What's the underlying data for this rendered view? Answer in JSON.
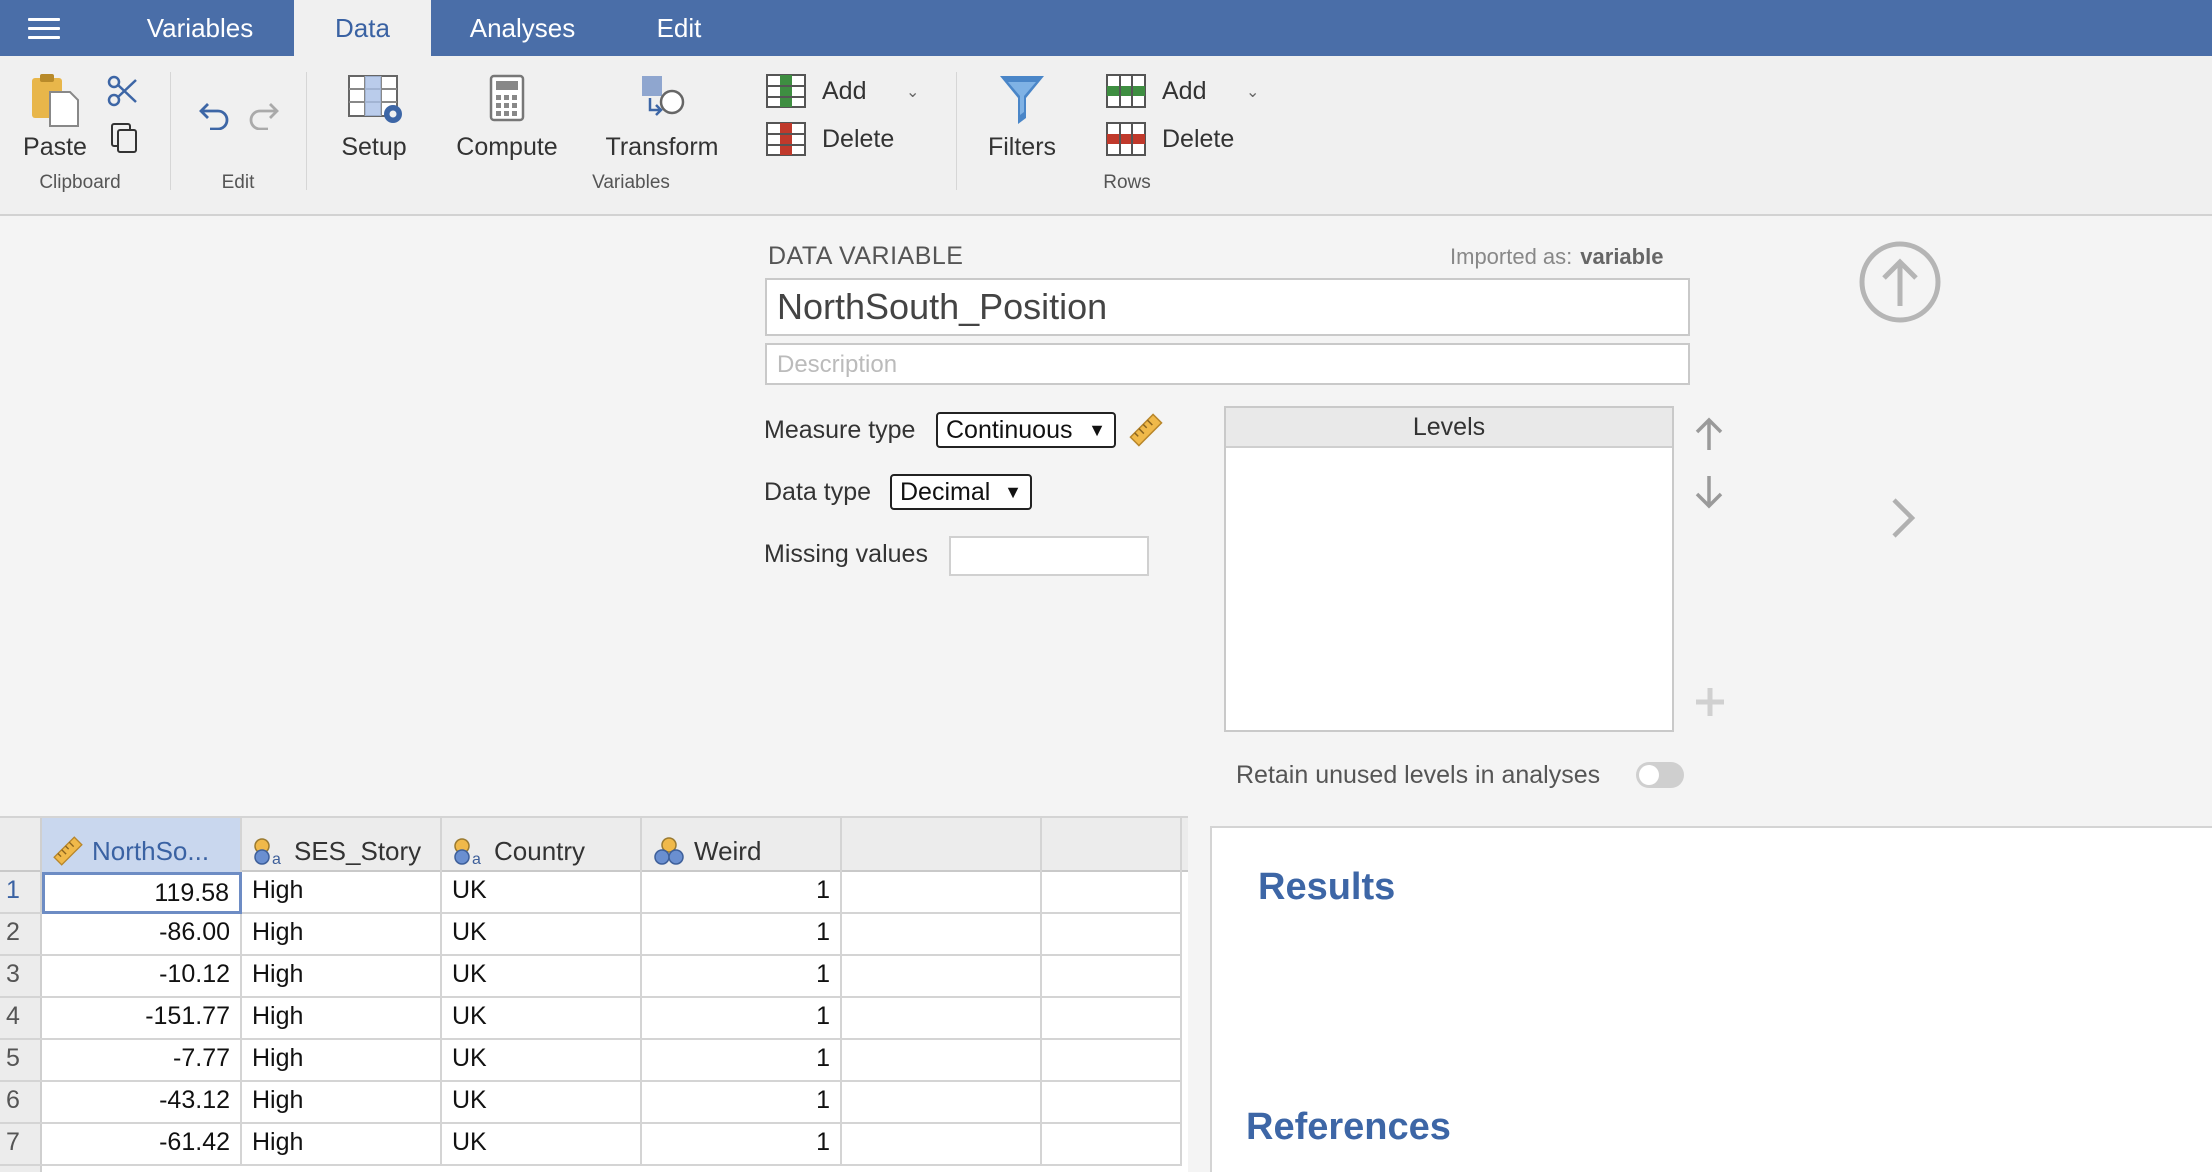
{
  "menubar": {
    "tabs": [
      {
        "label": "Variables"
      },
      {
        "label": "Data"
      },
      {
        "label": "Analyses"
      },
      {
        "label": "Edit"
      }
    ],
    "active_tab": "Data"
  },
  "ribbon": {
    "clipboard": {
      "paste": "Paste",
      "group": "Clipboard"
    },
    "edit": {
      "group": "Edit"
    },
    "variables": {
      "setup": "Setup",
      "compute": "Compute",
      "transform": "Transform",
      "add": "Add",
      "delete": "Delete",
      "group": "Variables"
    },
    "filters": {
      "label": "Filters"
    },
    "rows": {
      "add": "Add",
      "delete": "Delete",
      "group": "Rows"
    }
  },
  "editor": {
    "section_label": "DATA VARIABLE",
    "imported_label": "Imported as:",
    "imported_value": "variable",
    "name": "NorthSouth_Position",
    "description_placeholder": "Description",
    "measure_type_label": "Measure type",
    "measure_type": "Continuous",
    "data_type_label": "Data type",
    "data_type": "Decimal",
    "missing_label": "Missing values",
    "levels_label": "Levels",
    "retain_label": "Retain unused levels in analyses",
    "retain_on": false
  },
  "sheet": {
    "columns": [
      {
        "name": "NorthSo...",
        "type": "continuous"
      },
      {
        "name": "SES_Story",
        "type": "nominal-text"
      },
      {
        "name": "Country",
        "type": "nominal-text"
      },
      {
        "name": "Weird",
        "type": "nominal"
      },
      {
        "name": "",
        "type": ""
      },
      {
        "name": "",
        "type": ""
      }
    ],
    "rows": [
      {
        "n": "1",
        "cells": [
          "119.58",
          "High",
          "UK",
          "1"
        ]
      },
      {
        "n": "2",
        "cells": [
          "-86.00",
          "High",
          "UK",
          "1"
        ]
      },
      {
        "n": "3",
        "cells": [
          "-10.12",
          "High",
          "UK",
          "1"
        ]
      },
      {
        "n": "4",
        "cells": [
          "-151.77",
          "High",
          "UK",
          "1"
        ]
      },
      {
        "n": "5",
        "cells": [
          "-7.77",
          "High",
          "UK",
          "1"
        ]
      },
      {
        "n": "6",
        "cells": [
          "-43.12",
          "High",
          "UK",
          "1"
        ]
      },
      {
        "n": "7",
        "cells": [
          "-61.42",
          "High",
          "UK",
          "1"
        ]
      }
    ]
  },
  "results": {
    "title": "Results",
    "references": "References"
  },
  "colors": {
    "accent": "#4a6ea8",
    "heading": "#3d66a6",
    "selection": "#c9d7ee"
  }
}
